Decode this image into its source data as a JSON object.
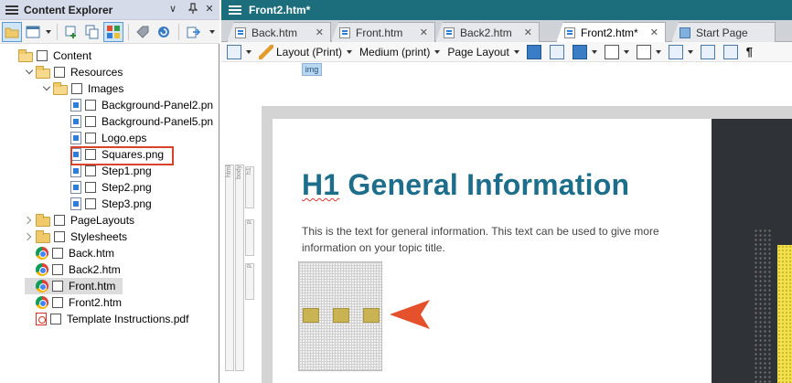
{
  "left_panel": {
    "title": "Content Explorer",
    "title_controls": [
      "∨",
      "✕"
    ],
    "tree": [
      {
        "label": "Content",
        "type": "folder-open",
        "depth": 0,
        "expanded": true
      },
      {
        "label": "Resources",
        "type": "folder-open",
        "depth": 1,
        "expanded": true
      },
      {
        "label": "Images",
        "type": "folder-open",
        "depth": 2,
        "expanded": true
      },
      {
        "label": "Background-Panel2.pn",
        "type": "image",
        "depth": 3
      },
      {
        "label": "Background-Panel5.pn",
        "type": "image",
        "depth": 3
      },
      {
        "label": "Logo.eps",
        "type": "image",
        "depth": 3
      },
      {
        "label": "Squares.png",
        "type": "image",
        "depth": 3,
        "highlighted": true
      },
      {
        "label": "Step1.png",
        "type": "image",
        "depth": 3
      },
      {
        "label": "Step2.png",
        "type": "image",
        "depth": 3
      },
      {
        "label": "Step3.png",
        "type": "image",
        "depth": 3
      },
      {
        "label": "PageLayouts",
        "type": "folder",
        "depth": 1,
        "expanded": false
      },
      {
        "label": "Stylesheets",
        "type": "folder",
        "depth": 1,
        "expanded": false
      },
      {
        "label": "Back.htm",
        "type": "chrome",
        "depth": 1
      },
      {
        "label": "Back2.htm",
        "type": "chrome",
        "depth": 1
      },
      {
        "label": "Front.htm",
        "type": "chrome",
        "depth": 1,
        "selected": true
      },
      {
        "label": "Front2.htm",
        "type": "chrome",
        "depth": 1
      },
      {
        "label": "Template Instructions.pdf",
        "type": "pdf",
        "depth": 1
      }
    ]
  },
  "editor": {
    "title": "Front2.htm*",
    "tabs": [
      {
        "label": "Back.htm",
        "active": false
      },
      {
        "label": "Front.htm",
        "active": false
      },
      {
        "label": "Back2.htm",
        "active": false
      },
      {
        "label": "Front2.htm*",
        "active": true
      },
      {
        "label": "Start Page",
        "active": false
      }
    ],
    "tab_close": "✕",
    "toolbar": {
      "layout": "Layout (Print)",
      "medium": "Medium (print)",
      "page_layout": "Page Layout",
      "pilcrow": "¶"
    },
    "selected_tag": "img",
    "structure_tags": [
      "html",
      "body",
      "h1",
      "p",
      "p"
    ],
    "document": {
      "heading_prefix": "H1",
      "heading_rest": " General Information",
      "paragraph": "This is the text for general information. This text can be used to give more information on your topic title."
    }
  },
  "colors": {
    "editor_title_bg": "#1c6e7d",
    "heading": "#1c6e8a",
    "highlight_box": "#d9432b",
    "arrow": "#e4512b",
    "yellow_accent": "#f2e14a"
  }
}
